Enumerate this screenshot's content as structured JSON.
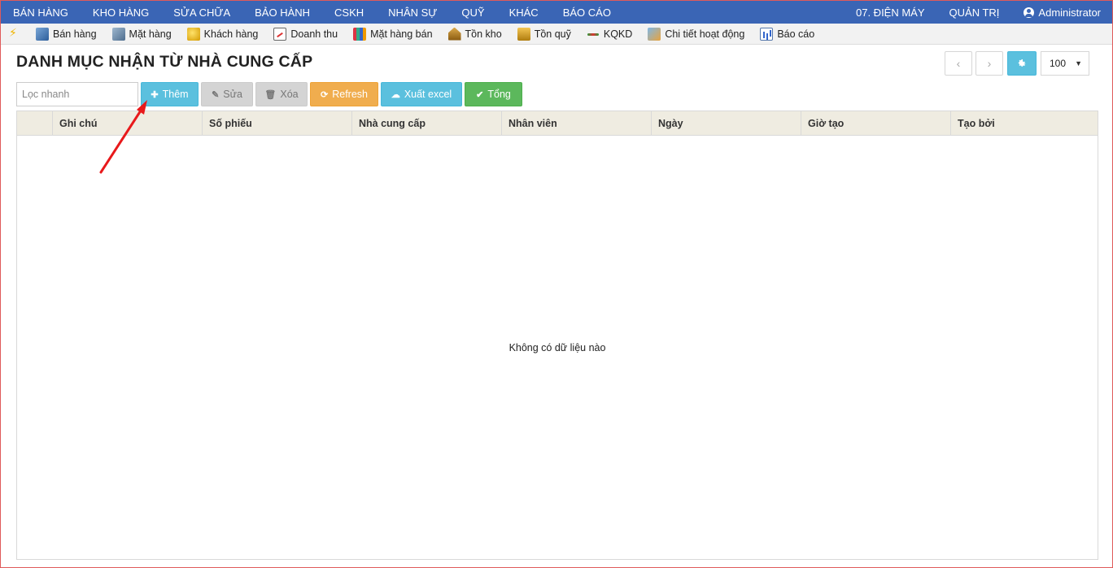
{
  "topnav": {
    "left": [
      "BÁN HÀNG",
      "KHO HÀNG",
      "SỬA CHỮA",
      "BẢO HÀNH",
      "CSKH",
      "NHÂN SỰ",
      "QUỸ",
      "KHÁC",
      "BÁO CÁO"
    ],
    "store": "07. ĐIỆN MÁY",
    "admin": "QUẢN TRỊ",
    "user": "Administrator"
  },
  "shortcuts": [
    {
      "label": "",
      "icon": "flash-icon"
    },
    {
      "label": "Bán hàng",
      "icon": "sale-icon"
    },
    {
      "label": "Mặt hàng",
      "icon": "item-icon"
    },
    {
      "label": "Khách hàng",
      "icon": "customer-icon"
    },
    {
      "label": "Doanh thu",
      "icon": "revenue-icon"
    },
    {
      "label": "Mặt hàng bán",
      "icon": "goods-sold-icon"
    },
    {
      "label": "Tồn kho",
      "icon": "stock-icon"
    },
    {
      "label": "Tồn quỹ",
      "icon": "fund-icon"
    },
    {
      "label": "KQKD",
      "icon": "business-result-icon"
    },
    {
      "label": "Chi tiết hoạt động",
      "icon": "activity-detail-icon"
    },
    {
      "label": "Báo cáo",
      "icon": "report-icon"
    }
  ],
  "page": {
    "title": "DANH MỤC NHẬN TỪ NHÀ CUNG CẤP"
  },
  "pager": {
    "prev": "‹",
    "next": "›",
    "page_size": "100"
  },
  "actions": {
    "filter_placeholder": "Lọc nhanh",
    "add": "Thêm",
    "edit": "Sửa",
    "delete": "Xóa",
    "refresh": "Refresh",
    "export": "Xuất excel",
    "total": "Tổng"
  },
  "grid": {
    "columns": [
      "Ghi chú",
      "Số phiếu",
      "Nhà cung cấp",
      "Nhân viên",
      "Ngày",
      "Giờ tạo",
      "Tạo bởi"
    ],
    "empty_message": "Không có dữ liệu nào"
  },
  "colors": {
    "nav_bg": "#3a65b5",
    "info": "#5bc0de",
    "warning": "#f0ad4e",
    "success": "#5cb85c",
    "annotation_arrow": "#e8191b"
  }
}
